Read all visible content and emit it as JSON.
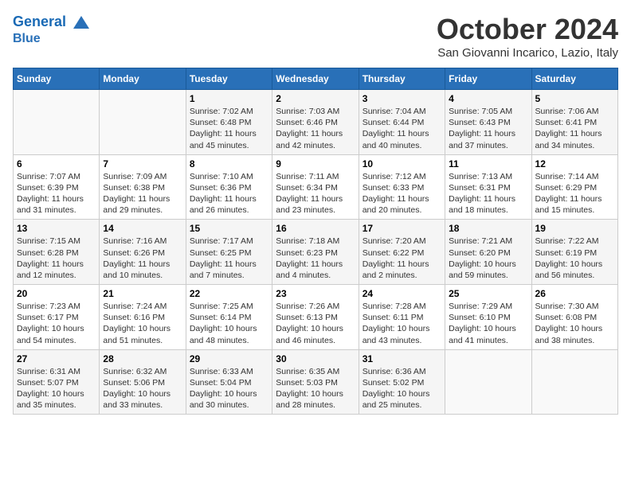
{
  "header": {
    "logo_line1": "General",
    "logo_line2": "Blue",
    "month_title": "October 2024",
    "location": "San Giovanni Incarico, Lazio, Italy"
  },
  "days_of_week": [
    "Sunday",
    "Monday",
    "Tuesday",
    "Wednesday",
    "Thursday",
    "Friday",
    "Saturday"
  ],
  "weeks": [
    [
      {
        "day": "",
        "info": ""
      },
      {
        "day": "",
        "info": ""
      },
      {
        "day": "1",
        "info": "Sunrise: 7:02 AM\nSunset: 6:48 PM\nDaylight: 11 hours and 45 minutes."
      },
      {
        "day": "2",
        "info": "Sunrise: 7:03 AM\nSunset: 6:46 PM\nDaylight: 11 hours and 42 minutes."
      },
      {
        "day": "3",
        "info": "Sunrise: 7:04 AM\nSunset: 6:44 PM\nDaylight: 11 hours and 40 minutes."
      },
      {
        "day": "4",
        "info": "Sunrise: 7:05 AM\nSunset: 6:43 PM\nDaylight: 11 hours and 37 minutes."
      },
      {
        "day": "5",
        "info": "Sunrise: 7:06 AM\nSunset: 6:41 PM\nDaylight: 11 hours and 34 minutes."
      }
    ],
    [
      {
        "day": "6",
        "info": "Sunrise: 7:07 AM\nSunset: 6:39 PM\nDaylight: 11 hours and 31 minutes."
      },
      {
        "day": "7",
        "info": "Sunrise: 7:09 AM\nSunset: 6:38 PM\nDaylight: 11 hours and 29 minutes."
      },
      {
        "day": "8",
        "info": "Sunrise: 7:10 AM\nSunset: 6:36 PM\nDaylight: 11 hours and 26 minutes."
      },
      {
        "day": "9",
        "info": "Sunrise: 7:11 AM\nSunset: 6:34 PM\nDaylight: 11 hours and 23 minutes."
      },
      {
        "day": "10",
        "info": "Sunrise: 7:12 AM\nSunset: 6:33 PM\nDaylight: 11 hours and 20 minutes."
      },
      {
        "day": "11",
        "info": "Sunrise: 7:13 AM\nSunset: 6:31 PM\nDaylight: 11 hours and 18 minutes."
      },
      {
        "day": "12",
        "info": "Sunrise: 7:14 AM\nSunset: 6:29 PM\nDaylight: 11 hours and 15 minutes."
      }
    ],
    [
      {
        "day": "13",
        "info": "Sunrise: 7:15 AM\nSunset: 6:28 PM\nDaylight: 11 hours and 12 minutes."
      },
      {
        "day": "14",
        "info": "Sunrise: 7:16 AM\nSunset: 6:26 PM\nDaylight: 11 hours and 10 minutes."
      },
      {
        "day": "15",
        "info": "Sunrise: 7:17 AM\nSunset: 6:25 PM\nDaylight: 11 hours and 7 minutes."
      },
      {
        "day": "16",
        "info": "Sunrise: 7:18 AM\nSunset: 6:23 PM\nDaylight: 11 hours and 4 minutes."
      },
      {
        "day": "17",
        "info": "Sunrise: 7:20 AM\nSunset: 6:22 PM\nDaylight: 11 hours and 2 minutes."
      },
      {
        "day": "18",
        "info": "Sunrise: 7:21 AM\nSunset: 6:20 PM\nDaylight: 10 hours and 59 minutes."
      },
      {
        "day": "19",
        "info": "Sunrise: 7:22 AM\nSunset: 6:19 PM\nDaylight: 10 hours and 56 minutes."
      }
    ],
    [
      {
        "day": "20",
        "info": "Sunrise: 7:23 AM\nSunset: 6:17 PM\nDaylight: 10 hours and 54 minutes."
      },
      {
        "day": "21",
        "info": "Sunrise: 7:24 AM\nSunset: 6:16 PM\nDaylight: 10 hours and 51 minutes."
      },
      {
        "day": "22",
        "info": "Sunrise: 7:25 AM\nSunset: 6:14 PM\nDaylight: 10 hours and 48 minutes."
      },
      {
        "day": "23",
        "info": "Sunrise: 7:26 AM\nSunset: 6:13 PM\nDaylight: 10 hours and 46 minutes."
      },
      {
        "day": "24",
        "info": "Sunrise: 7:28 AM\nSunset: 6:11 PM\nDaylight: 10 hours and 43 minutes."
      },
      {
        "day": "25",
        "info": "Sunrise: 7:29 AM\nSunset: 6:10 PM\nDaylight: 10 hours and 41 minutes."
      },
      {
        "day": "26",
        "info": "Sunrise: 7:30 AM\nSunset: 6:08 PM\nDaylight: 10 hours and 38 minutes."
      }
    ],
    [
      {
        "day": "27",
        "info": "Sunrise: 6:31 AM\nSunset: 5:07 PM\nDaylight: 10 hours and 35 minutes."
      },
      {
        "day": "28",
        "info": "Sunrise: 6:32 AM\nSunset: 5:06 PM\nDaylight: 10 hours and 33 minutes."
      },
      {
        "day": "29",
        "info": "Sunrise: 6:33 AM\nSunset: 5:04 PM\nDaylight: 10 hours and 30 minutes."
      },
      {
        "day": "30",
        "info": "Sunrise: 6:35 AM\nSunset: 5:03 PM\nDaylight: 10 hours and 28 minutes."
      },
      {
        "day": "31",
        "info": "Sunrise: 6:36 AM\nSunset: 5:02 PM\nDaylight: 10 hours and 25 minutes."
      },
      {
        "day": "",
        "info": ""
      },
      {
        "day": "",
        "info": ""
      }
    ]
  ]
}
